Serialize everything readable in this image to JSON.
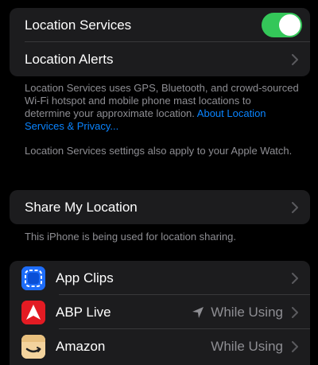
{
  "location_group": {
    "location_services": {
      "label": "Location Services",
      "toggle_on": true
    },
    "location_alerts": {
      "label": "Location Alerts"
    }
  },
  "location_footnote": {
    "text": "Location Services uses GPS, Bluetooth, and crowd-sourced Wi-Fi hotspot and mobile phone mast locations to determine your approximate location. ",
    "link": "About Location Services & Privacy..."
  },
  "watch_footnote": {
    "text": "Location Services settings also apply to your Apple Watch."
  },
  "share_group": {
    "share_my_location": {
      "label": "Share My Location"
    }
  },
  "share_footnote": {
    "text": "This iPhone is being used for location sharing."
  },
  "apps": [
    {
      "name": "App Clips",
      "icon": "app-clips-icon",
      "value": ""
    },
    {
      "name": "ABP Live",
      "icon": "abp-live-icon",
      "value": "While Using",
      "recent_location_used": true
    },
    {
      "name": "Amazon",
      "icon": "amazon-icon",
      "value": "While Using"
    }
  ],
  "colors": {
    "background": "#000000",
    "cell": "#1c1c1e",
    "toggle_on": "#34c759",
    "link": "#0a84ff",
    "secondary_text": "#8e8e93"
  }
}
